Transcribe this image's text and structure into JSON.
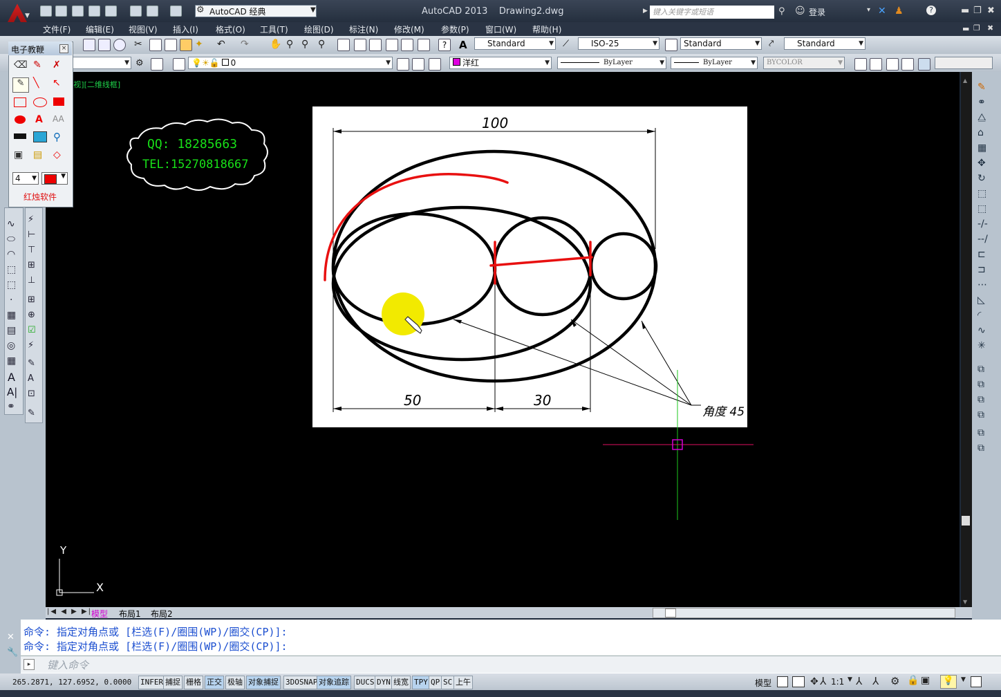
{
  "title_bar": {
    "workspace": "AutoCAD 经典",
    "app_title": "AutoCAD 2013    Drawing2.dwg",
    "search_placeholder": "键入关键字或短语",
    "login": "登录"
  },
  "menu": [
    "文件(F)",
    "编辑(E)",
    "视图(V)",
    "插入(I)",
    "格式(O)",
    "工具(T)",
    "绘图(D)",
    "标注(N)",
    "修改(M)",
    "参数(P)",
    "窗口(W)",
    "帮助(H)"
  ],
  "toolbar1": {
    "text_style": "Standard",
    "dim_style": "ISO-25",
    "table_style": "Standard",
    "mleader_style": "Standard"
  },
  "toolbar2": {
    "layer": "0",
    "color": "洋红",
    "linetype": "ByLayer",
    "lineweight": "ByLayer",
    "plotstyle": "BYCOLOR"
  },
  "viewport_label": "[视][二维线框]",
  "electronic_teaching": {
    "title": "电子教鞭",
    "close": "×",
    "pen_size": "4",
    "footer": "红烛软件"
  },
  "contact": {
    "qq": "QQ: 18285663",
    "tel": "TEL:15270818667"
  },
  "drawing": {
    "dim_total": "100",
    "dim_left": "50",
    "dim_mid": "30",
    "leader_note": "角度 45"
  },
  "ucs": {
    "x": "X",
    "y": "Y"
  },
  "tabs": [
    "模型",
    "布局1",
    "布局2"
  ],
  "command_history": [
    "命令: 指定对角点或 [栏选(F)/圈围(WP)/圈交(CP)]:",
    "命令: 指定对角点或 [栏选(F)/圈围(WP)/圈交(CP)]:"
  ],
  "command_placeholder": "键入命令",
  "status": {
    "coords": "265.2871, 127.6952, 0.0000",
    "buttons": [
      {
        "label": "INFER",
        "on": false
      },
      {
        "label": "捕捉",
        "on": false
      },
      {
        "label": "栅格",
        "on": false
      },
      {
        "label": "正交",
        "on": true
      },
      {
        "label": "极轴",
        "on": false
      },
      {
        "label": "对象捕捉",
        "on": true
      },
      {
        "label": "3DOSNAP",
        "on": false
      },
      {
        "label": "对象追踪",
        "on": true
      },
      {
        "label": "DUCS",
        "on": false
      },
      {
        "label": "DYN",
        "on": false
      },
      {
        "label": "线宽",
        "on": false
      },
      {
        "label": "TPY",
        "on": true
      },
      {
        "label": "QP",
        "on": false
      },
      {
        "label": "SC",
        "on": false
      },
      {
        "label": "上午",
        "on": false
      }
    ],
    "model": "模型",
    "scale": "1:1"
  },
  "colors": {
    "canvas": "#000000",
    "paper": "#ffffff",
    "annotation_red": "#e81010",
    "highlight_yellow": "#f2ea00",
    "crosshair_green": "#1ec81e",
    "crosshair_red": "#e01060",
    "contact_green": "#18e018"
  }
}
